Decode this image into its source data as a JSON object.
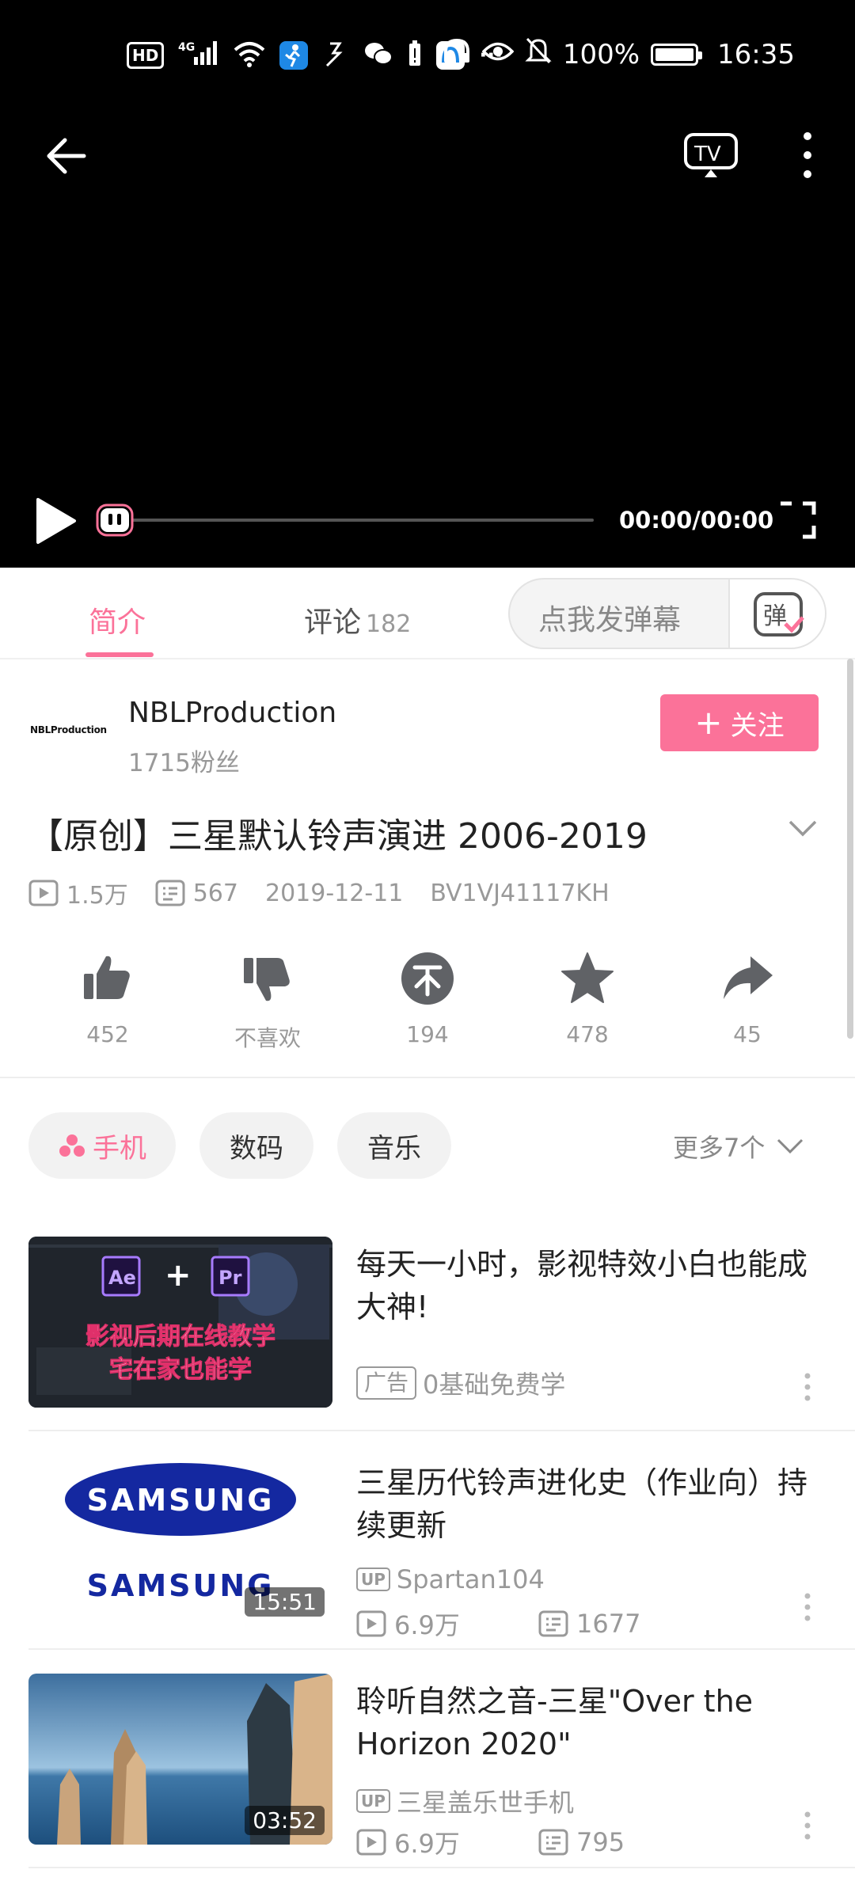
{
  "status_bar": {
    "hd": "HD",
    "signal": "4G",
    "battery": "100%",
    "time": "16:35",
    "battery_level": 1.0
  },
  "player": {
    "time": "00:00/00:00",
    "progress": 0.0
  },
  "tabs": {
    "intro": "简介",
    "comments": "评论",
    "comments_count": "182",
    "danmaku_placeholder": "点我发弹幕"
  },
  "uploader": {
    "avatar_text": "NBLProduction",
    "name": "NBLProduction",
    "fans": "1715粉丝",
    "follow": "关注"
  },
  "video": {
    "title": "【原创】三星默认铃声演进 2006-2019",
    "views": "1.5万",
    "danmaku": "567",
    "date": "2019-12-11",
    "bvid": "BV1VJ41117KH"
  },
  "actions": {
    "like": "452",
    "dislike": "不喜欢",
    "coin": "194",
    "favorite": "478",
    "share": "45"
  },
  "tags": {
    "items": [
      "手机",
      "数码",
      "音乐"
    ],
    "more": "更多7个"
  },
  "related": [
    {
      "title": "每天一小时，影视特效小白也能成大神!",
      "ad_label": "广告",
      "ad_text": "0基础免费学",
      "thumb_lines": [
        "影视后期在线教学",
        "宅在家也能学"
      ],
      "thumb_logos": [
        "Ae",
        "Pr"
      ]
    },
    {
      "title": "三星历代铃声进化史（作业向）持续更新",
      "up_label": "UP",
      "up_name": "Spartan104",
      "views": "6.9万",
      "danmaku": "1677",
      "duration": "15:51",
      "thumb_logo": "SAMSUNG"
    },
    {
      "title": "聆听自然之音-三星\"Over the Horizon 2020\"",
      "up_label": "UP",
      "up_name": "三星盖乐世手机",
      "views": "6.9万",
      "danmaku": "795",
      "duration": "03:52"
    }
  ],
  "colors": {
    "accent": "#fb7299",
    "text_secondary": "#999999",
    "player_bg": "#000000"
  }
}
